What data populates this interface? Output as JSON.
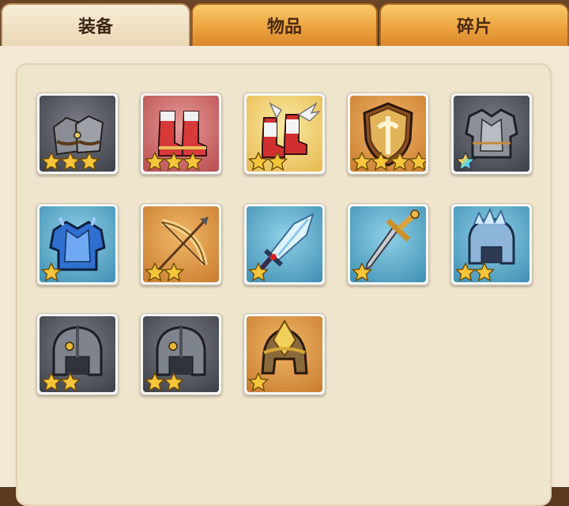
{
  "tabs": [
    {
      "label": "装备",
      "active": true
    },
    {
      "label": "物品",
      "active": false
    },
    {
      "label": "碎片",
      "active": false
    }
  ],
  "items": [
    {
      "icon": "gauntlets-icon",
      "bg": "gray",
      "stars": 3
    },
    {
      "icon": "boots-icon",
      "bg": "red",
      "stars": 3
    },
    {
      "icon": "winged-boots-icon",
      "bg": "yellow",
      "stars": 2
    },
    {
      "icon": "shield-icon",
      "bg": "orange",
      "stars": 4
    },
    {
      "icon": "chest-armor-icon",
      "bg": "gray",
      "stars": 1,
      "rainbow_star": true
    },
    {
      "icon": "blue-armor-icon",
      "bg": "blue",
      "stars": 1
    },
    {
      "icon": "bow-icon",
      "bg": "orange",
      "stars": 2
    },
    {
      "icon": "crystal-sword-icon",
      "bg": "blue",
      "stars": 1
    },
    {
      "icon": "dagger-icon",
      "bg": "blue",
      "stars": 1
    },
    {
      "icon": "crystal-helmet-icon",
      "bg": "blue",
      "stars": 2
    },
    {
      "icon": "iron-helmet-icon",
      "bg": "gray",
      "stars": 2
    },
    {
      "icon": "iron-helmet-icon",
      "bg": "gray",
      "stars": 2
    },
    {
      "icon": "gold-helmet-icon",
      "bg": "orange",
      "stars": 1
    }
  ],
  "colors": {
    "gray": [
      "#7b7e85",
      "#3c3f47"
    ],
    "red": [
      "#e79a98",
      "#b84c4e"
    ],
    "yellow": [
      "#fbeaa3",
      "#e6b94f"
    ],
    "orange": [
      "#f0b767",
      "#c97b2f"
    ],
    "blue": [
      "#8fd0e6",
      "#3f8fb4"
    ],
    "star": "#f7c53a"
  }
}
